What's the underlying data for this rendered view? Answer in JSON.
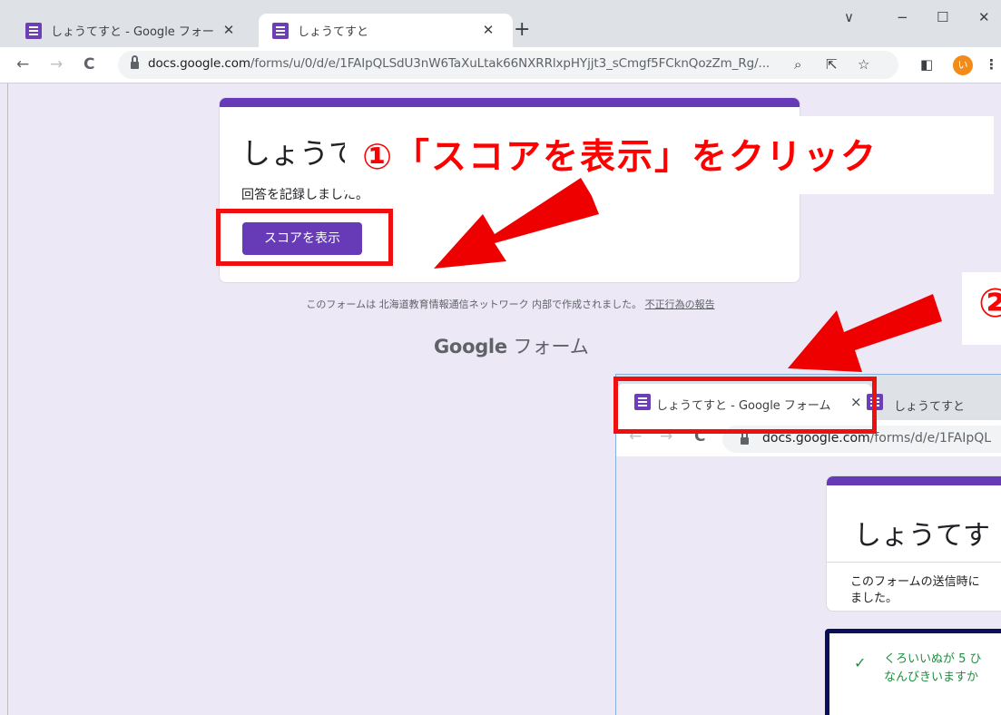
{
  "browser": {
    "tabs": [
      {
        "title": "しょうてすと - Google フォーム",
        "active": false
      },
      {
        "title": "しょうてすと",
        "active": true
      }
    ],
    "new_tab": "+",
    "window_controls": [
      "∨",
      "−",
      "☐",
      "✕"
    ],
    "url_host": "docs.google.com",
    "url_path": "/forms/u/0/d/e/1FAIpQLSdU3nW6TaXuLtak66NXRRlxpHYjjt3_sCmgf5FCknQozZm_Rg/...",
    "nav": {
      "back": "←",
      "forward": "→",
      "reload": "C"
    },
    "profile_initial": "い",
    "icons": [
      "zoom-icon",
      "share-icon",
      "bookmark-star-icon",
      "sidepanel-icon",
      "menu-icon"
    ]
  },
  "form": {
    "title": "しょうて",
    "message": "回答を記録しました。",
    "score_button": "スコアを表示",
    "footer_note_prefix": "このフォームは 北海道教育情報通信ネットワーク 内部で作成されました。",
    "footer_note_link": "不正行為の報告",
    "logo_google": "Google",
    "logo_forms": "フォーム",
    "accent_color": "#673ab7"
  },
  "annotations": {
    "step1": "①「スコアを表示」をクリック",
    "step2": "②",
    "color": "#ff0000"
  },
  "inset": {
    "tab1_title": "しょうてすと - Google フォーム",
    "tab1_close": "×",
    "tab2_title": "しょうてすと",
    "url_host": "docs.google.com",
    "url_path": "/forms/d/e/1FAIpQL",
    "title": "しょうてす",
    "note_line1": "このフォームの送信時に",
    "note_line2": "ました。",
    "question_line1": "くろいいぬが 5 ひ",
    "question_line2": "なんびきいますか"
  }
}
